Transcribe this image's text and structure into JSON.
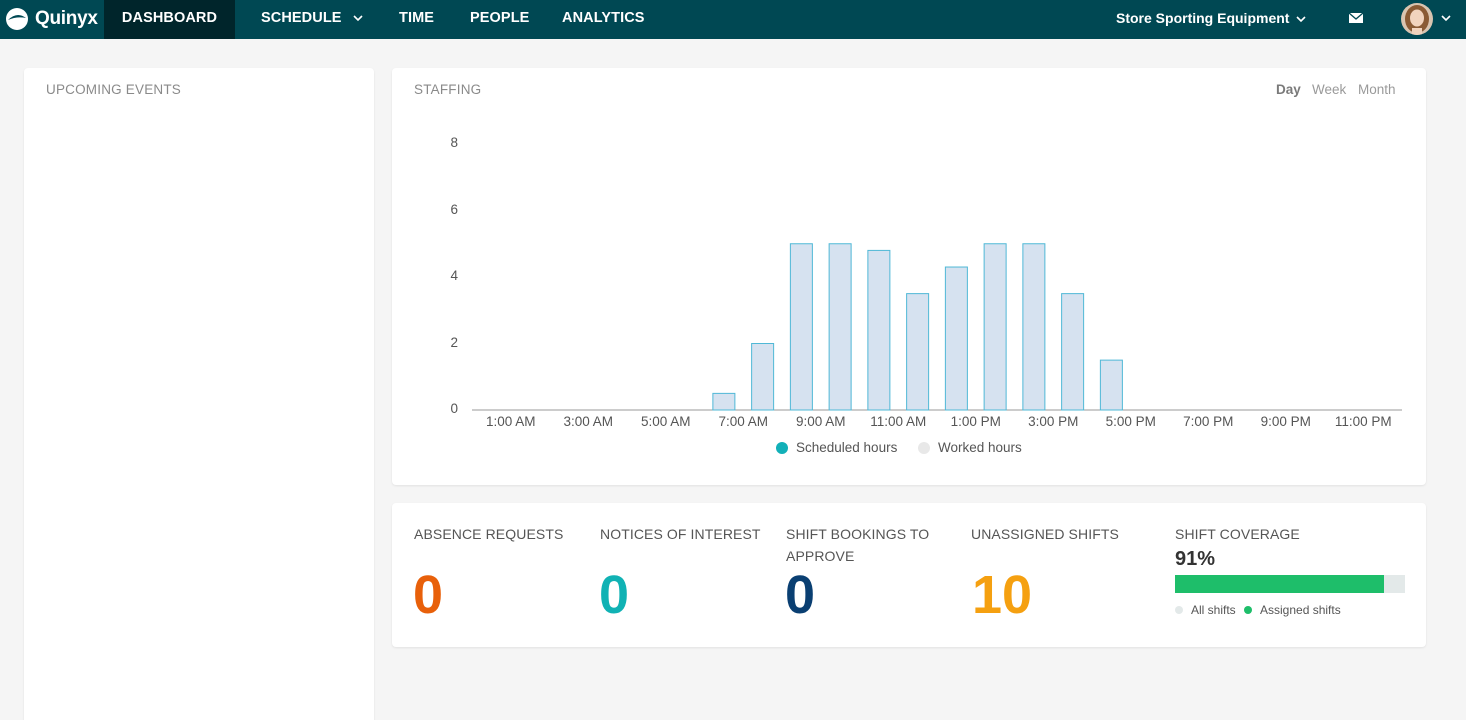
{
  "app": {
    "logo_text": "Quinyx",
    "nav": {
      "dashboard": "DASHBOARD",
      "schedule": "SCHEDULE",
      "time": "TIME",
      "people": "PEOPLE",
      "analytics": "ANALYTICS"
    },
    "store_selector": "Store Sporting Equipment",
    "header_bg": "#004853"
  },
  "upcoming_events": {
    "title": "UPCOMING EVENTS"
  },
  "staffing": {
    "title": "STAFFING",
    "periods": {
      "day": "Day",
      "week": "Week",
      "month": "Month",
      "selected": "Day"
    }
  },
  "chart_data": {
    "type": "bar",
    "title": "",
    "hours": [
      0,
      1,
      2,
      3,
      4,
      5,
      6,
      7,
      8,
      9,
      10,
      11,
      12,
      13,
      14,
      15,
      16,
      17,
      18,
      19,
      20,
      21,
      22,
      23
    ],
    "x_tick_labels": [
      "1:00 AM",
      "3:00 AM",
      "5:00 AM",
      "7:00 AM",
      "9:00 AM",
      "11:00 AM",
      "1:00 PM",
      "3:00 PM",
      "5:00 PM",
      "7:00 PM",
      "9:00 PM",
      "11:00 PM"
    ],
    "y_tick_labels": [
      "0",
      "2",
      "4",
      "6",
      "8"
    ],
    "ylim": [
      0,
      8
    ],
    "series": [
      {
        "name": "Scheduled hours",
        "color": "#12b0b8",
        "values": [
          0,
          0,
          0,
          0,
          0,
          0,
          0.5,
          2,
          5,
          5,
          4.8,
          3.5,
          4.3,
          5,
          5,
          3.5,
          1.5,
          0,
          0,
          0,
          0,
          0,
          0,
          0
        ]
      },
      {
        "name": "Worked hours",
        "color": "#e0e0e0",
        "values": [
          0,
          0,
          0,
          0,
          0,
          0,
          0,
          0,
          0,
          0,
          0,
          0,
          0,
          0,
          0,
          0,
          0,
          0,
          0,
          0,
          0,
          0,
          0,
          0
        ]
      }
    ],
    "bar_fill": "#d6e2f0",
    "bar_stroke": "#4fb8d6",
    "legend_position": "bottom",
    "grid": false
  },
  "metrics": {
    "absence": {
      "label": "ABSENCE REQUESTS",
      "value": "0",
      "color": "#e8600a"
    },
    "notices": {
      "label": "NOTICES OF INTEREST",
      "value": "0",
      "color": "#10b2b4"
    },
    "bookings": {
      "label_line1": "SHIFT BOOKINGS TO",
      "label_line2": "APPROVE",
      "value": "0",
      "color": "#0a3f72"
    },
    "unassigned": {
      "label": "UNASSIGNED SHIFTS",
      "value": "10",
      "color": "#f5a010"
    },
    "coverage": {
      "label": "SHIFT COVERAGE",
      "value": "91%",
      "fraction": 0.91,
      "fill_color": "#1ebe6a",
      "track_color": "#e3e9e9",
      "legend_all": "All shifts",
      "legend_assigned": "Assigned shifts"
    }
  }
}
